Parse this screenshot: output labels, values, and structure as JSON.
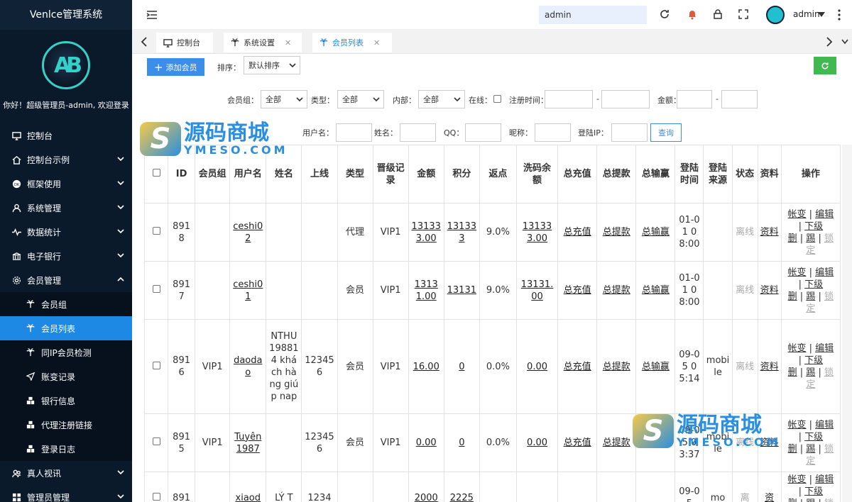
{
  "app": {
    "title": "Venlce管理系统",
    "welcome": "你好！超级管理员-admin, 欢迎登录"
  },
  "sidebar": {
    "items": [
      {
        "label": "控制台",
        "icon": "monitor-icon",
        "has_children": false
      },
      {
        "label": "控制台示例",
        "icon": "home-icon",
        "has_children": true
      },
      {
        "label": "框架使用",
        "icon": "ok-badge-icon",
        "has_children": true
      },
      {
        "label": "系统管理",
        "icon": "user-icon",
        "has_children": true
      },
      {
        "label": "数据统计",
        "icon": "pulse-icon",
        "has_children": true
      },
      {
        "label": "电子银行",
        "icon": "bank-icon",
        "has_children": true
      },
      {
        "label": "会员管理",
        "icon": "gear-icon",
        "has_children": true,
        "expanded": true
      }
    ],
    "subitems": [
      {
        "label": "会员组",
        "icon": "palm-icon",
        "active": false
      },
      {
        "label": "会员列表",
        "icon": "palm-icon",
        "active": true
      },
      {
        "label": "同IP会员检测",
        "icon": "palm-icon",
        "active": false
      },
      {
        "label": "账变记录",
        "icon": "send-icon",
        "active": false
      },
      {
        "label": "银行信息",
        "icon": "cubes-icon",
        "active": false
      },
      {
        "label": "代理注册链接",
        "icon": "cubes-icon",
        "active": false
      },
      {
        "label": "登录日志",
        "icon": "cubes-icon",
        "active": false
      }
    ],
    "bottom": [
      {
        "label": "真人视讯",
        "icon": "users-icon",
        "has_children": true
      },
      {
        "label": "管理员管理",
        "icon": "grid-icon",
        "has_children": true
      }
    ]
  },
  "topbar": {
    "search_value": "admin",
    "user": "admin"
  },
  "tabs": [
    {
      "label": "控制台",
      "icon": "monitor-icon",
      "active": false,
      "closable": false
    },
    {
      "label": "系统设置",
      "icon": "palm-icon",
      "active": false,
      "closable": true
    },
    {
      "label": "会员列表",
      "icon": "palm-icon",
      "active": true,
      "closable": true
    }
  ],
  "toolbar": {
    "add_label": "添加会员",
    "sort_label": "排序：",
    "sort_value": "默认排序"
  },
  "filters": {
    "group_label": "会员组：",
    "group_value": "全部",
    "type_label": "类型：",
    "type_value": "全部",
    "internal_label": "内部：",
    "internal_value": "全部",
    "online_label": "在线：",
    "regtime_label": "注册时间：",
    "dash": "-",
    "amount_label": "金额：",
    "username_label": "用户名：",
    "name_label": "姓名：",
    "qq_label": "QQ：",
    "nick_label": "昵称：",
    "ip_label": "登陆IP：",
    "query_label": "查询"
  },
  "watermark": {
    "cn": "源码商城",
    "en": "YMESO.COM"
  },
  "table": {
    "headers": [
      "",
      "ID",
      "会员组",
      "用户名",
      "姓名",
      "上线",
      "类型",
      "晋级记录",
      "金额",
      "积分",
      "返点",
      "洗码余额",
      "总充值",
      "总提款",
      "总输赢",
      "登陆时间",
      "登陆来源",
      "状态",
      "资料",
      "操作"
    ],
    "ops": {
      "a": "帐变",
      "b": "编辑",
      "c": "下级",
      "d": "删",
      "e": "踢",
      "f": "锁定",
      "sep": "|"
    },
    "rows": [
      {
        "id": "8918",
        "group": "",
        "username": "ceshi02",
        "name": "",
        "upline": "",
        "type": "代理",
        "level": "VIP1",
        "amount": "131333.00",
        "points": "131333",
        "rebate": "9.0%",
        "wash": "131333.00",
        "recharge": "总充值",
        "withdraw": "总提款",
        "winloss": "总输赢",
        "logintime": "01-01 08:00",
        "source": "",
        "status": "离线",
        "info": "资料"
      },
      {
        "id": "8917",
        "group": "",
        "username": "ceshi01",
        "name": "",
        "upline": "",
        "type": "会员",
        "level": "VIP1",
        "amount": "13131.00",
        "points": "13131",
        "rebate": "9.0%",
        "wash": "13131.00",
        "recharge": "总充值",
        "withdraw": "总提款",
        "winloss": "总输赢",
        "logintime": "01-01 08:00",
        "source": "",
        "status": "离线",
        "info": "资料"
      },
      {
        "id": "8916",
        "group": "VIP1",
        "username": "daodao",
        "name": "NTHU198814 khách hàng giúp nap",
        "upline": "123456",
        "type": "会员",
        "level": "VIP1",
        "amount": "16.00",
        "points": "0",
        "rebate": "0.0%",
        "wash": "0.00",
        "recharge": "总充值",
        "withdraw": "总提款",
        "winloss": "总输赢",
        "logintime": "09-05 05:14",
        "source": "mobile",
        "status": "离线",
        "info": "资料"
      },
      {
        "id": "8915",
        "group": "VIP1",
        "username": "Tuyên 1987",
        "name": "",
        "upline": "123456",
        "type": "会员",
        "level": "VIP1",
        "amount": "0.00",
        "points": "0",
        "rebate": "0.0%",
        "wash": "0.00",
        "recharge": "总充值",
        "withdraw": "总提款",
        "winloss": "总输赢",
        "logintime": "09-05 03:37",
        "source": "mobile",
        "status": "离线",
        "info": "资料"
      },
      {
        "id": "891",
        "group": "",
        "username": "xiaod",
        "name": "LÝ T",
        "upline": "1234",
        "type": "",
        "level": "",
        "amount": "2000",
        "points": "2225",
        "rebate": "",
        "wash": "",
        "recharge": "",
        "withdraw": "",
        "winloss": "",
        "logintime": "09-05",
        "source": "mo",
        "status": "离",
        "info": "资"
      }
    ]
  }
}
